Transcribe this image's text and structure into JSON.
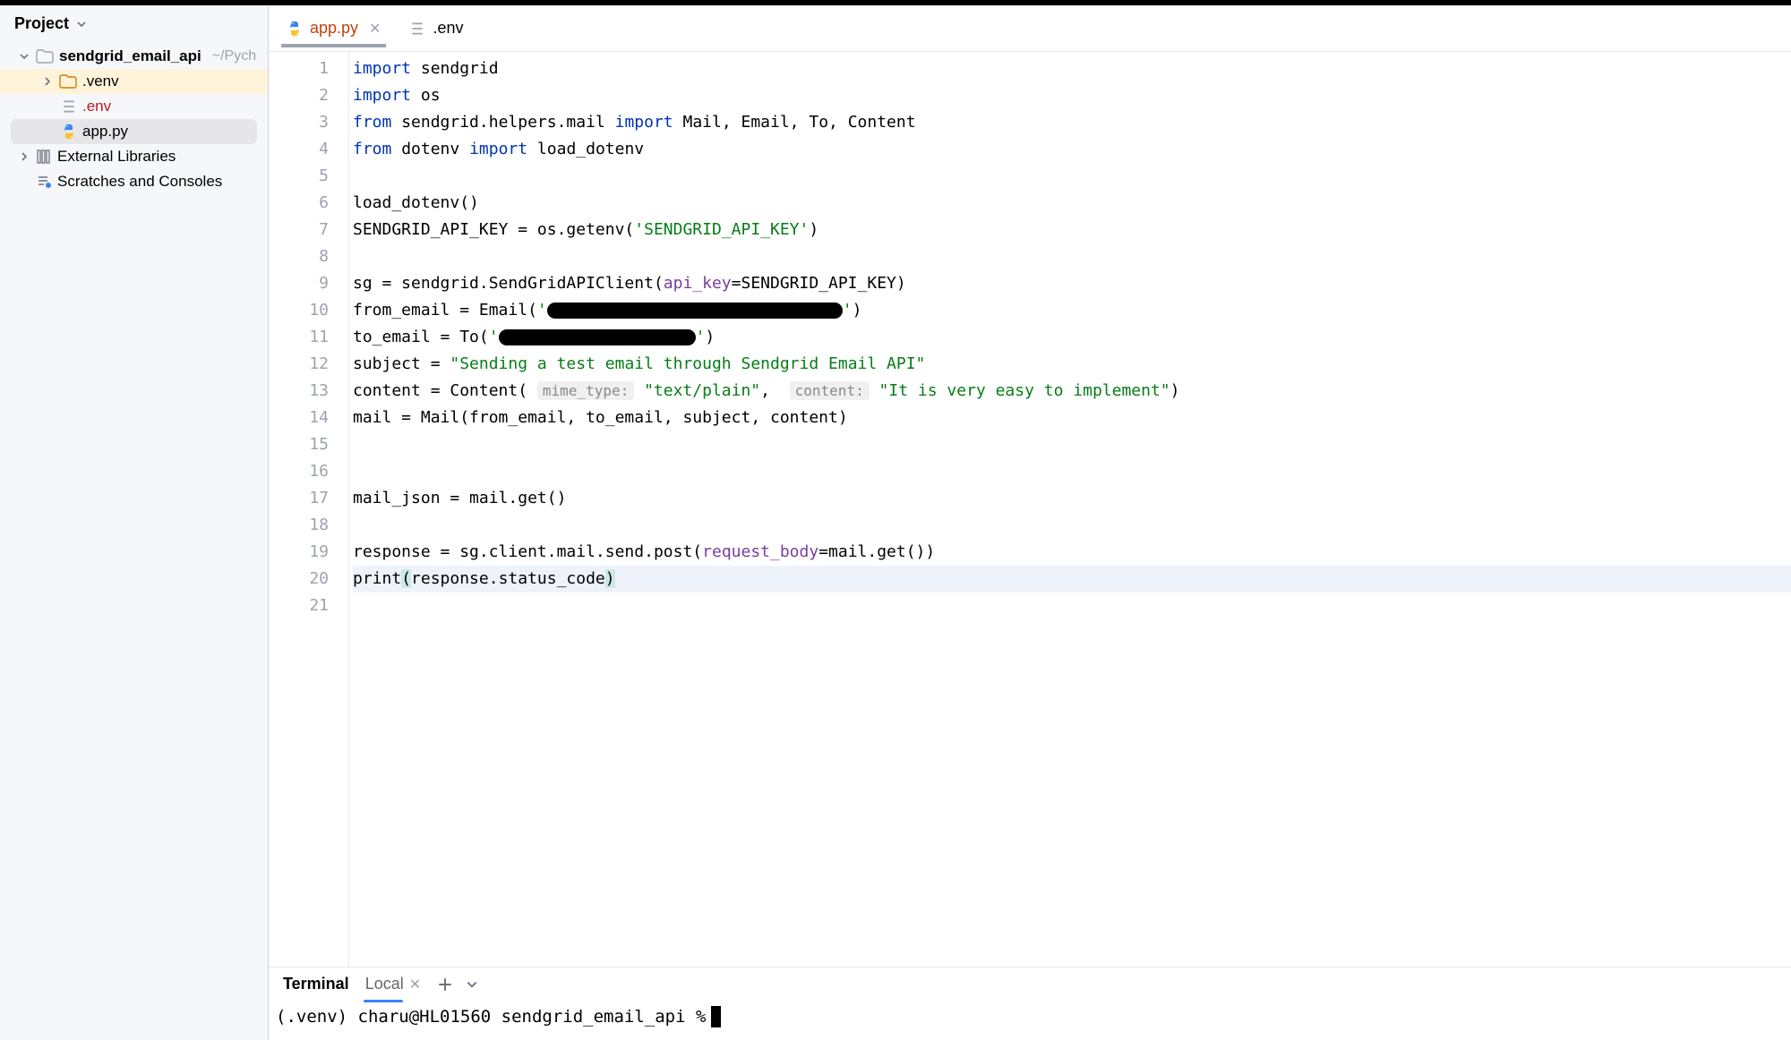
{
  "sidebar": {
    "title": "Project",
    "tree": {
      "root": {
        "label": "sendgrid_email_api",
        "path": "~/Pych"
      },
      "venv": {
        "label": ".venv"
      },
      "env": {
        "label": ".env"
      },
      "app": {
        "label": "app.py"
      },
      "external": {
        "label": "External Libraries"
      },
      "scratches": {
        "label": "Scratches and Consoles"
      }
    }
  },
  "tabs": {
    "app": {
      "label": "app.py"
    },
    "env": {
      "label": ".env"
    }
  },
  "code": {
    "l1_kw": "import",
    "l1_rest": " sendgrid",
    "l2_kw": "import",
    "l2_rest": " os",
    "l3_kw1": "from",
    "l3_mid": " sendgrid.helpers.mail ",
    "l3_kw2": "import",
    "l3_rest": " Mail, Email, To, Content",
    "l4_kw1": "from",
    "l4_mid": " dotenv ",
    "l4_kw2": "import",
    "l4_rest": " load_dotenv",
    "l6": "load_dotenv()",
    "l7_a": "SENDGRID_API_KEY = os.getenv(",
    "l7_str": "'SENDGRID_API_KEY'",
    "l7_b": ")",
    "l9_a": "sg = sendgrid.SendGridAPIClient(",
    "l9_param": "api_key",
    "l9_b": "=SENDGRID_API_KEY)",
    "l10_a": "from_email = Email(",
    "l10_q1": "'",
    "l10_q2": "'",
    "l10_b": ")",
    "l11_a": "to_email = To(",
    "l11_q1": "'",
    "l11_q2": "'",
    "l11_b": ")",
    "l12_a": "subject = ",
    "l12_str": "\"Sending a test email through Sendgrid Email API\"",
    "l13_a": "content = Content( ",
    "l13_h1": "mime_type:",
    "l13_s1": " \"text/plain\"",
    "l13_c": ",  ",
    "l13_h2": "content:",
    "l13_s2": " \"It is very easy to implement\"",
    "l13_b": ")",
    "l14": "mail = Mail(from_email, to_email, subject, content)",
    "l17": "mail_json = mail.get()",
    "l19_a": "response = sg.client.mail.send.post(",
    "l19_param": "request_body",
    "l19_b": "=mail.get())",
    "l20_a": "print",
    "l20_p1": "(",
    "l20_mid": "response.status_code",
    "l20_p2": ")"
  },
  "bottom": {
    "terminal_label": "Terminal",
    "local_label": "Local",
    "prompt": "(.venv) charu@HL01560 sendgrid_email_api % "
  }
}
